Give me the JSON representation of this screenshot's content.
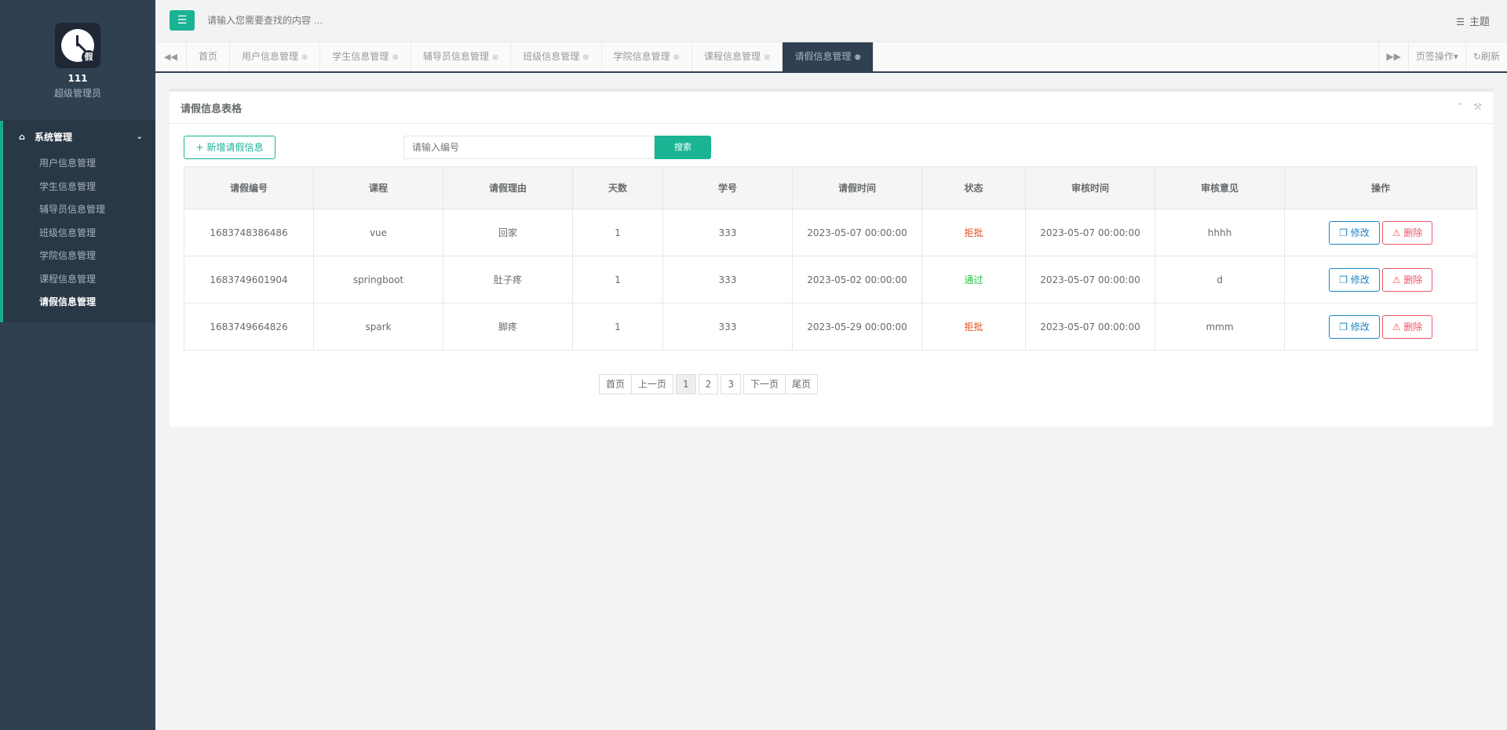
{
  "sidebar": {
    "user_name": "111",
    "user_role": "超级管理员",
    "group_label": "系统管理",
    "items": [
      {
        "label": "用户信息管理",
        "active": false
      },
      {
        "label": "学生信息管理",
        "active": false
      },
      {
        "label": "辅导员信息管理",
        "active": false
      },
      {
        "label": "班级信息管理",
        "active": false
      },
      {
        "label": "学院信息管理",
        "active": false
      },
      {
        "label": "课程信息管理",
        "active": false
      },
      {
        "label": "请假信息管理",
        "active": true
      }
    ]
  },
  "topbar": {
    "search_placeholder": "请输入您需要查找的内容 …",
    "theme_label": "主题"
  },
  "tabs": {
    "items": [
      {
        "label": "首页",
        "closable": false
      },
      {
        "label": "用户信息管理",
        "closable": true
      },
      {
        "label": "学生信息管理",
        "closable": true
      },
      {
        "label": "辅导员信息管理",
        "closable": true
      },
      {
        "label": "班级信息管理",
        "closable": true
      },
      {
        "label": "学院信息管理",
        "closable": true
      },
      {
        "label": "课程信息管理",
        "closable": true
      },
      {
        "label": "请假信息管理",
        "closable": true
      }
    ],
    "page_ops_label": "页签操作",
    "refresh_label": "刷新"
  },
  "panel": {
    "title": "请假信息表格",
    "add_button": "新增请假信息",
    "search_placeholder": "请输入编号",
    "search_button": "搜索"
  },
  "table": {
    "headers": [
      "请假编号",
      "课程",
      "请假理由",
      "天数",
      "学号",
      "请假时间",
      "状态",
      "审核时间",
      "审核意见",
      "操作"
    ],
    "rows": [
      [
        "1683748386486",
        "vue",
        "回家",
        "1",
        "333",
        "2023-05-07 00:00:00",
        "拒批",
        "2023-05-07 00:00:00",
        "hhhh"
      ],
      [
        "1683749601904",
        "springboot",
        "肚子疼",
        "1",
        "333",
        "2023-05-02 00:00:00",
        "通过",
        "2023-05-07 00:00:00",
        "d"
      ],
      [
        "1683749664826",
        "spark",
        "脚疼",
        "1",
        "333",
        "2023-05-29 00:00:00",
        "拒批",
        "2023-05-07 00:00:00",
        "mmm"
      ]
    ],
    "edit_label": "修改",
    "delete_label": "删除"
  },
  "pager": {
    "first": "首页",
    "prev": "上一页",
    "pages": [
      "1",
      "2",
      "3"
    ],
    "current": "1",
    "next": "下一页",
    "last": "尾页"
  },
  "colors": {
    "accent": "#1ab394",
    "sidebar": "#2f4050",
    "reject": "#e04c1b",
    "pass": "#23c23f",
    "edit": "#1c84c6",
    "delete": "#ed5565"
  },
  "icons": {
    "menu": "bars-icon",
    "theme": "list-icon",
    "home": "home-icon",
    "chevron": "chevron-down-icon",
    "tab_prev": "backward-icon",
    "tab_next": "forward-icon",
    "close": "close-circle-icon",
    "refresh": "refresh-icon",
    "collapse": "chevron-up-icon",
    "settings": "wrench-icon",
    "add": "plus-icon",
    "edit": "copy-icon",
    "delete": "warning-icon"
  }
}
